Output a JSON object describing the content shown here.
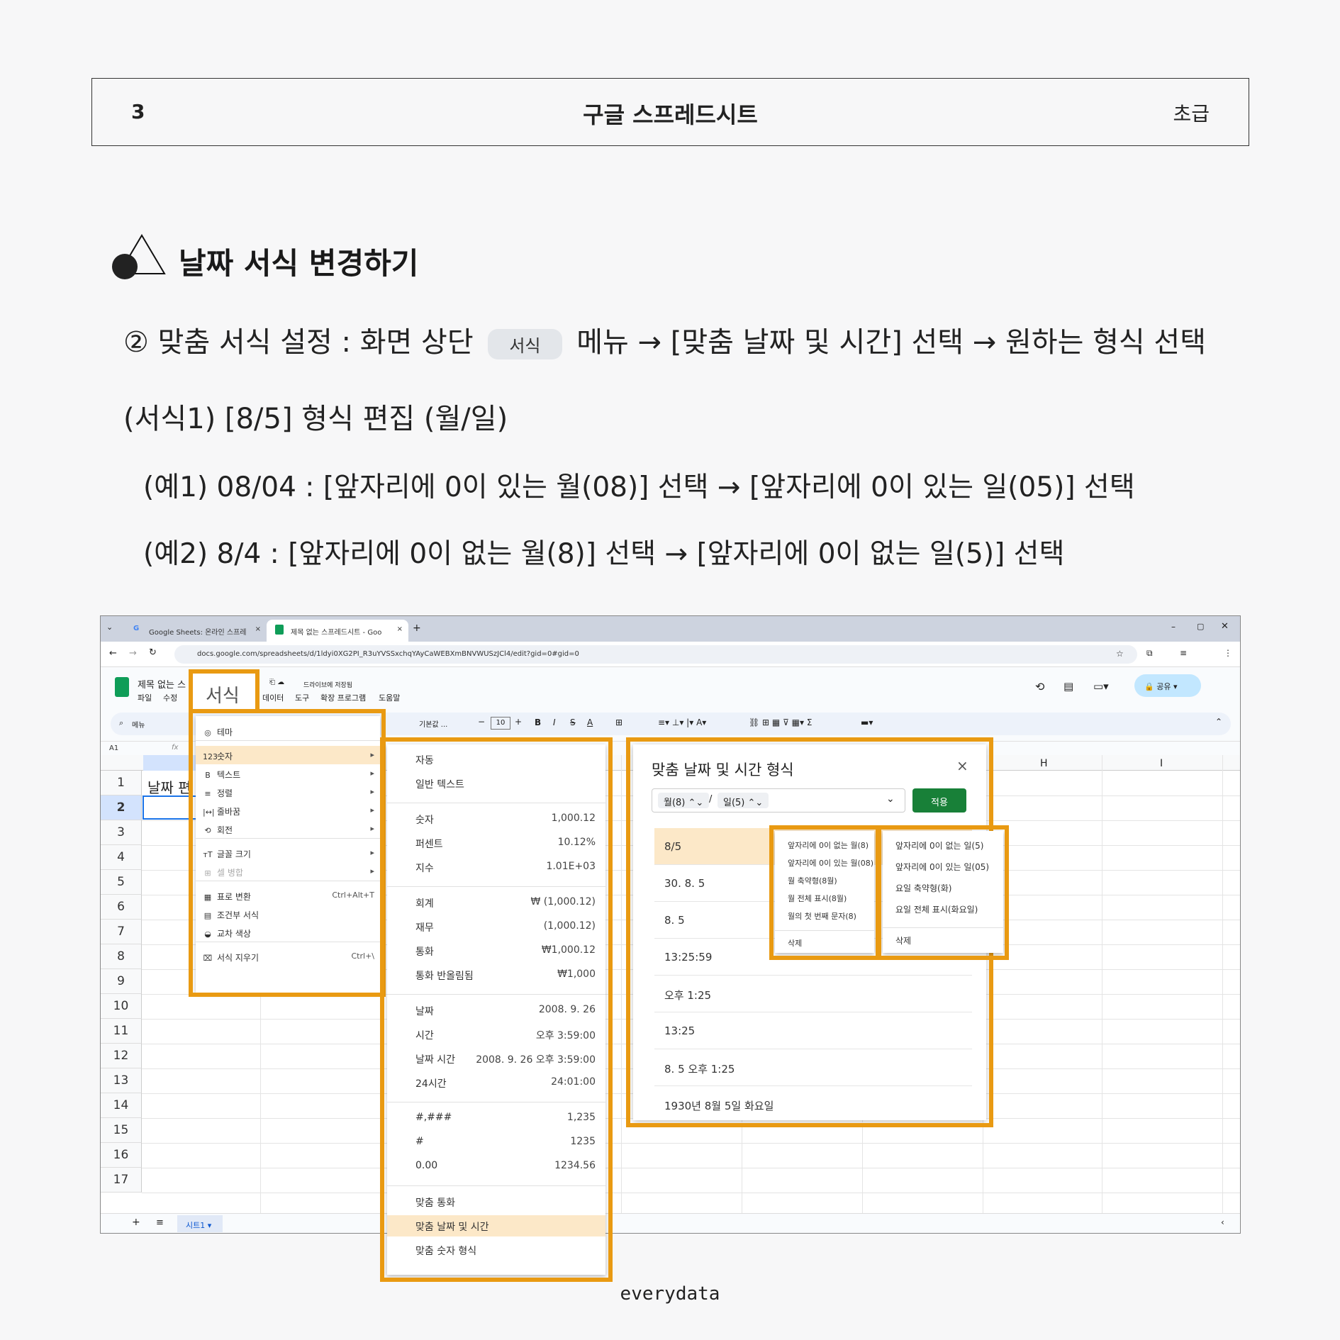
{
  "header": {
    "page_number": "3",
    "title": "구글 스프레드시트",
    "level": "초급"
  },
  "section_title": "날짜 서식 변경하기",
  "instruction": {
    "prefix": "② 맞춤 서식 설정 : 화면 상단",
    "chip": "서식",
    "suffix": "메뉴 → [맞춤 날짜 및 시간] 선택 → 원하는 형식 선택"
  },
  "format_heading": "(서식1) [8/5] 형식 편집 (월/일)",
  "example1": "(예1) 08/04 : [앞자리에 0이 있는 월(08)] 선택 → [앞자리에 0이 있는 일(05)] 선택",
  "example2": "(예2) 8/4 : [앞자리에 0이 없는 월(8)] 선택 → [앞자리에 0이 없는 일(5)] 선택",
  "footer": "everydata",
  "browser": {
    "tab1": "Google Sheets: 온라인 스프레",
    "tab2": "제목 없는 스프레드시트 - Goo",
    "url": "docs.google.com/spreadsheets/d/1ldyi0XG2PI_R3uYVSSxchqYAyCaWEBXmBNVWUSzJCl4/edit?gid=0#gid=0"
  },
  "sheets": {
    "doc_title": "제목 없는 스",
    "menus": [
      "파일",
      "수정",
      "데이터",
      "도구",
      "확장 프로그램",
      "도움말"
    ],
    "saved": "드라이브에 저장됨",
    "share": "공유",
    "search": "메뉴",
    "font": "기본값 ...",
    "font_size": "10",
    "cell_ref": "A1",
    "cell_a1": "날짜 편",
    "col_h": "H",
    "col_i": "I",
    "rows": [
      "1",
      "2",
      "3",
      "4",
      "5",
      "6",
      "7",
      "8",
      "9",
      "10",
      "11",
      "12",
      "13",
      "14",
      "15",
      "16",
      "17"
    ],
    "sheet_tab": "시트1"
  },
  "format_menu": {
    "label": "서식",
    "items": [
      {
        "icon": "palette-icon",
        "glyph": "◎",
        "label": "테마",
        "shortcut": ""
      },
      {
        "icon": "number-icon",
        "glyph": "123",
        "label": "숫자",
        "shortcut": "▸"
      },
      {
        "icon": "bold-icon",
        "glyph": "B",
        "label": "텍스트",
        "shortcut": "▸"
      },
      {
        "icon": "align-icon",
        "glyph": "≡",
        "label": "정렬",
        "shortcut": "▸"
      },
      {
        "icon": "wrap-icon",
        "glyph": "|↔|",
        "label": "줄바꿈",
        "shortcut": "▸"
      },
      {
        "icon": "rotate-icon",
        "glyph": "⟲",
        "label": "회전",
        "shortcut": "▸"
      },
      {
        "icon": "font-size-icon",
        "glyph": "тT",
        "label": "글꼴 크기",
        "shortcut": "▸"
      },
      {
        "icon": "merge-icon",
        "glyph": "⊞",
        "label": "셀 병합",
        "shortcut": "▸"
      },
      {
        "icon": "table-icon",
        "glyph": "▦",
        "label": "표로 변환",
        "shortcut": "Ctrl+Alt+T"
      },
      {
        "icon": "conditional-icon",
        "glyph": "▤",
        "label": "조건부 서식",
        "shortcut": ""
      },
      {
        "icon": "alternating-icon",
        "glyph": "◒",
        "label": "교차 색상",
        "shortcut": ""
      },
      {
        "icon": "clear-format-icon",
        "glyph": "⌧",
        "label": "서식 지우기",
        "shortcut": "Ctrl+\\"
      }
    ]
  },
  "number_submenu": [
    {
      "label": "자동",
      "value": ""
    },
    {
      "label": "일반 텍스트",
      "value": ""
    },
    {
      "label": "숫자",
      "value": "1,000.12"
    },
    {
      "label": "퍼센트",
      "value": "10.12%"
    },
    {
      "label": "지수",
      "value": "1.01E+03"
    },
    {
      "label": "회계",
      "value": "₩ (1,000.12)"
    },
    {
      "label": "재무",
      "value": "(1,000.12)"
    },
    {
      "label": "통화",
      "value": "₩1,000.12"
    },
    {
      "label": "통화 반올림됨",
      "value": "₩1,000"
    },
    {
      "label": "날짜",
      "value": "2008. 9. 26"
    },
    {
      "label": "시간",
      "value": "오후 3:59:00"
    },
    {
      "label": "날짜 시간",
      "value": "2008. 9. 26 오후 3:59:00"
    },
    {
      "label": "24시간",
      "value": "24:01:00"
    },
    {
      "label": "#,###",
      "value": "1,235"
    },
    {
      "label": "#",
      "value": "1235"
    },
    {
      "label": "0.00",
      "value": "1234.56"
    },
    {
      "label": "맞춤 통화",
      "value": ""
    },
    {
      "label": "맞춤 날짜 및 시간",
      "value": ""
    },
    {
      "label": "맞춤 숫자 형식",
      "value": ""
    }
  ],
  "dialog": {
    "title": "맞춤 날짜 및 시간 형식",
    "month_chip": "월(8)",
    "sep": "/",
    "day_chip": "일(5)",
    "apply": "적용",
    "formats": [
      "8/5",
      "30. 8. 5",
      "8. 5",
      "13:25:59",
      "오후 1:25",
      "13:25",
      "8. 5 오후 1:25",
      "1930년 8월 5일 화요일"
    ]
  },
  "month_popup": [
    "앞자리에 0이 없는 월(8)",
    "앞자리에 0이 있는 월(08)",
    "월 축약형(8월)",
    "월 전체 표시(8월)",
    "월의 첫 번째 문자(8)",
    "삭제"
  ],
  "day_popup": [
    "앞자리에 0이 없는 일(5)",
    "앞자리에 0이 있는 일(05)",
    "요일 축약형(화)",
    "요일 전체 표시(화요일)",
    "삭제"
  ],
  "colors": {
    "highlight": "#e99a12",
    "selected": "#fce8c8",
    "apply": "#188038"
  }
}
